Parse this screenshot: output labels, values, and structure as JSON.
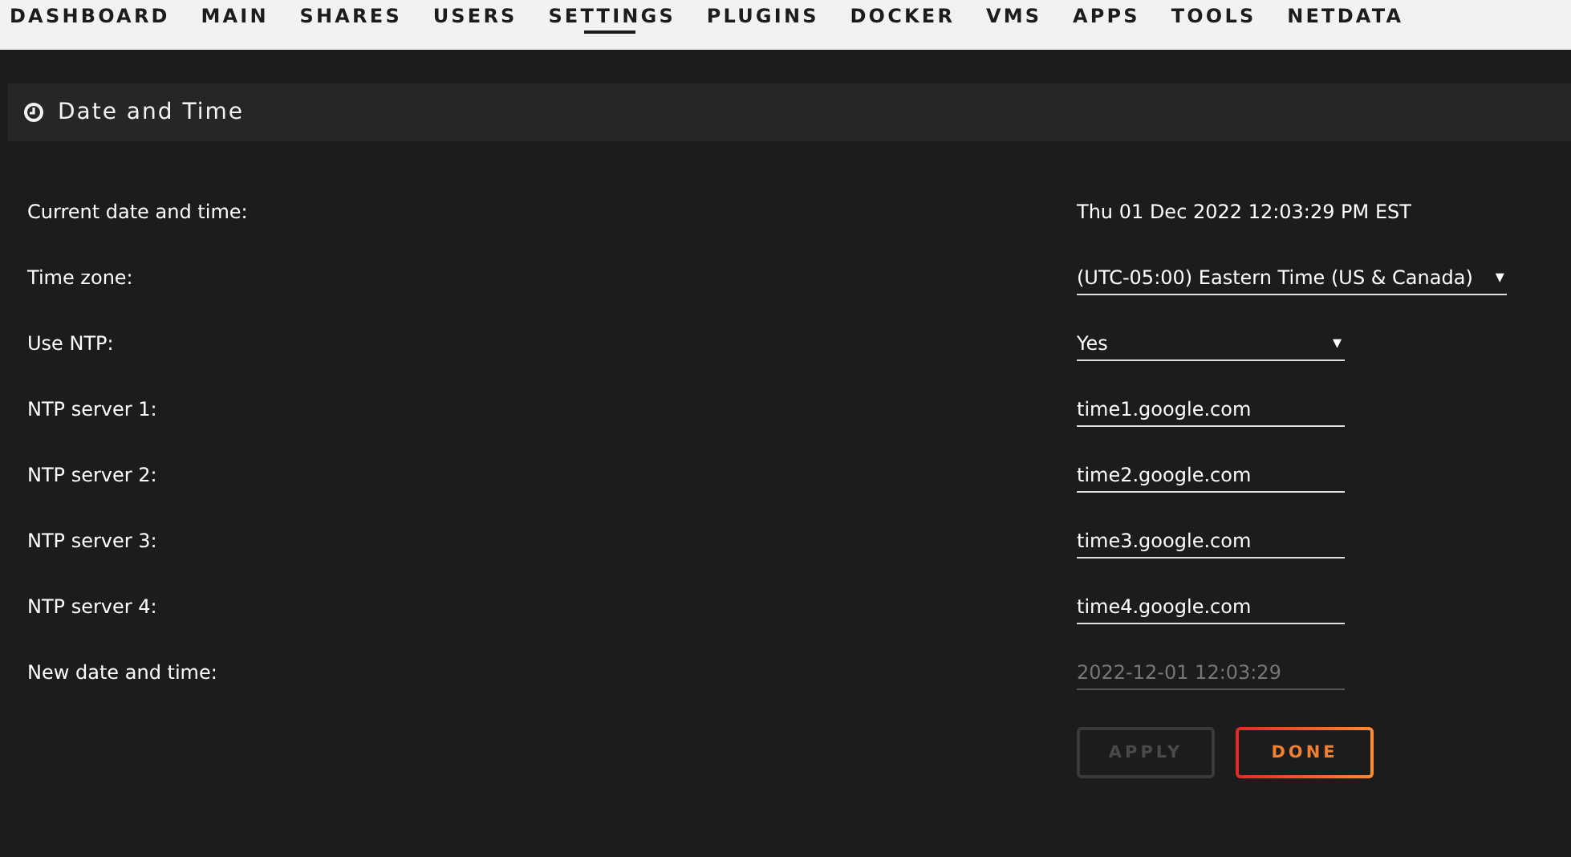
{
  "nav": [
    {
      "label": "DASHBOARD",
      "selected": false
    },
    {
      "label": "MAIN",
      "selected": false
    },
    {
      "label": "SHARES",
      "selected": false
    },
    {
      "label": "USERS",
      "selected": false
    },
    {
      "label": "SETTINGS",
      "selected": true
    },
    {
      "label": "PLUGINS",
      "selected": false
    },
    {
      "label": "DOCKER",
      "selected": false
    },
    {
      "label": "VMS",
      "selected": false
    },
    {
      "label": "APPS",
      "selected": false
    },
    {
      "label": "TOOLS",
      "selected": false
    },
    {
      "label": "NETDATA",
      "selected": false
    }
  ],
  "panel": {
    "title": "Date and Time"
  },
  "rows": [
    {
      "label": "Current date and time:",
      "kind": "text",
      "value": "Thu 01 Dec 2022 12:03:29 PM EST"
    },
    {
      "label": "Time zone:",
      "kind": "select",
      "value": "(UTC-05:00) Eastern Time (US & Canada)",
      "arrow": "▾"
    },
    {
      "label": "Use NTP:",
      "kind": "select",
      "value": "Yes",
      "arrow": "▾"
    },
    {
      "label": "NTP server 1:",
      "kind": "input",
      "value": "time1.google.com",
      "disabled": false
    },
    {
      "label": "NTP server 2:",
      "kind": "input",
      "value": "time2.google.com",
      "disabled": false
    },
    {
      "label": "NTP server 3:",
      "kind": "input",
      "value": "time3.google.com",
      "disabled": false
    },
    {
      "label": "NTP server 4:",
      "kind": "input",
      "value": "time4.google.com",
      "disabled": false
    },
    {
      "label": "New date and time:",
      "kind": "input",
      "value": "2022-12-01 12:03:29",
      "disabled": true
    }
  ],
  "buttons": [
    {
      "label": "APPLY",
      "disabled": true
    },
    {
      "label": "DONE",
      "disabled": false
    }
  ]
}
